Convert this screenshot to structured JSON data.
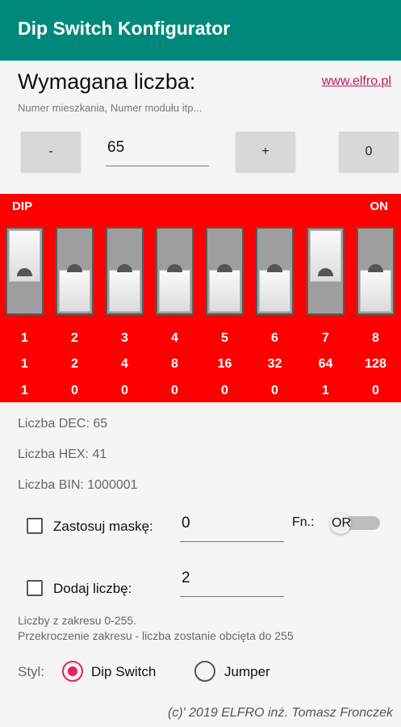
{
  "appbar": {
    "title": "Dip Switch Konfigurator",
    "color": "#00897b"
  },
  "required": {
    "label": "Wymagana liczba:",
    "link": "www.elfro.pl",
    "hint": "Numer mieszkania, Numer modułu itp...",
    "minus_label": "-",
    "value": "65",
    "plus_label": "+",
    "zero_label": "0"
  },
  "dip": {
    "left_label": "DIP",
    "right_label": "ON",
    "panel_color": "#ff0000",
    "switches": [
      {
        "pos": "1",
        "weight": "1",
        "bit": "1",
        "state": "up"
      },
      {
        "pos": "2",
        "weight": "2",
        "bit": "0",
        "state": "down"
      },
      {
        "pos": "3",
        "weight": "4",
        "bit": "0",
        "state": "down"
      },
      {
        "pos": "4",
        "weight": "8",
        "bit": "0",
        "state": "down"
      },
      {
        "pos": "5",
        "weight": "16",
        "bit": "0",
        "state": "down"
      },
      {
        "pos": "6",
        "weight": "32",
        "bit": "0",
        "state": "down"
      },
      {
        "pos": "7",
        "weight": "64",
        "bit": "1",
        "state": "up"
      },
      {
        "pos": "8",
        "weight": "128",
        "bit": "0",
        "state": "down"
      }
    ]
  },
  "info": {
    "dec": "Liczba DEC: 65",
    "hex": "Liczba HEX: 41",
    "bin": "Liczba BIN: 1000001"
  },
  "mask": {
    "label": "Zastosuj maskę:",
    "value": "0",
    "checked": false
  },
  "fn": {
    "label": "Fn.:",
    "toggle_text": "OR",
    "on": false
  },
  "add": {
    "label": "Dodaj liczbę:",
    "value": "2",
    "checked": false
  },
  "notes": {
    "line1": "Liczby z zakresu 0-255.",
    "line2": "Przekroczenie zakresu - liczba zostanie obcięta do 255"
  },
  "style": {
    "label": "Styl:",
    "options": [
      {
        "label": "Dip Switch",
        "selected": true
      },
      {
        "label": "Jumper",
        "selected": false
      }
    ],
    "accent": "#e91e63"
  },
  "footer": "(c)' 2019 ELFRO inż. Tomasz Fronczek"
}
